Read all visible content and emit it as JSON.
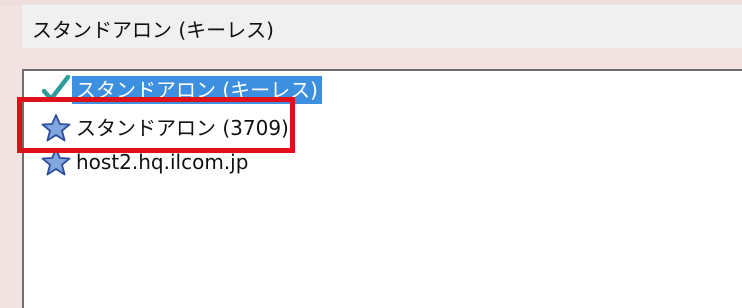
{
  "selected_value": "スタンドアロン (キーレス)",
  "list": {
    "items": [
      {
        "label": "スタンドアロン (キーレス)",
        "icon": "checkmark-icon",
        "selected": true
      },
      {
        "label": "スタンドアロン (3709)",
        "icon": "star-icon",
        "selected": false
      },
      {
        "label": "host2.hq.ilcom.jp",
        "icon": "star-icon",
        "selected": false
      }
    ]
  },
  "colors": {
    "selection_bg": "#3d8fe0",
    "highlight": "#e0101a",
    "star_fill": "#7fa7de"
  }
}
